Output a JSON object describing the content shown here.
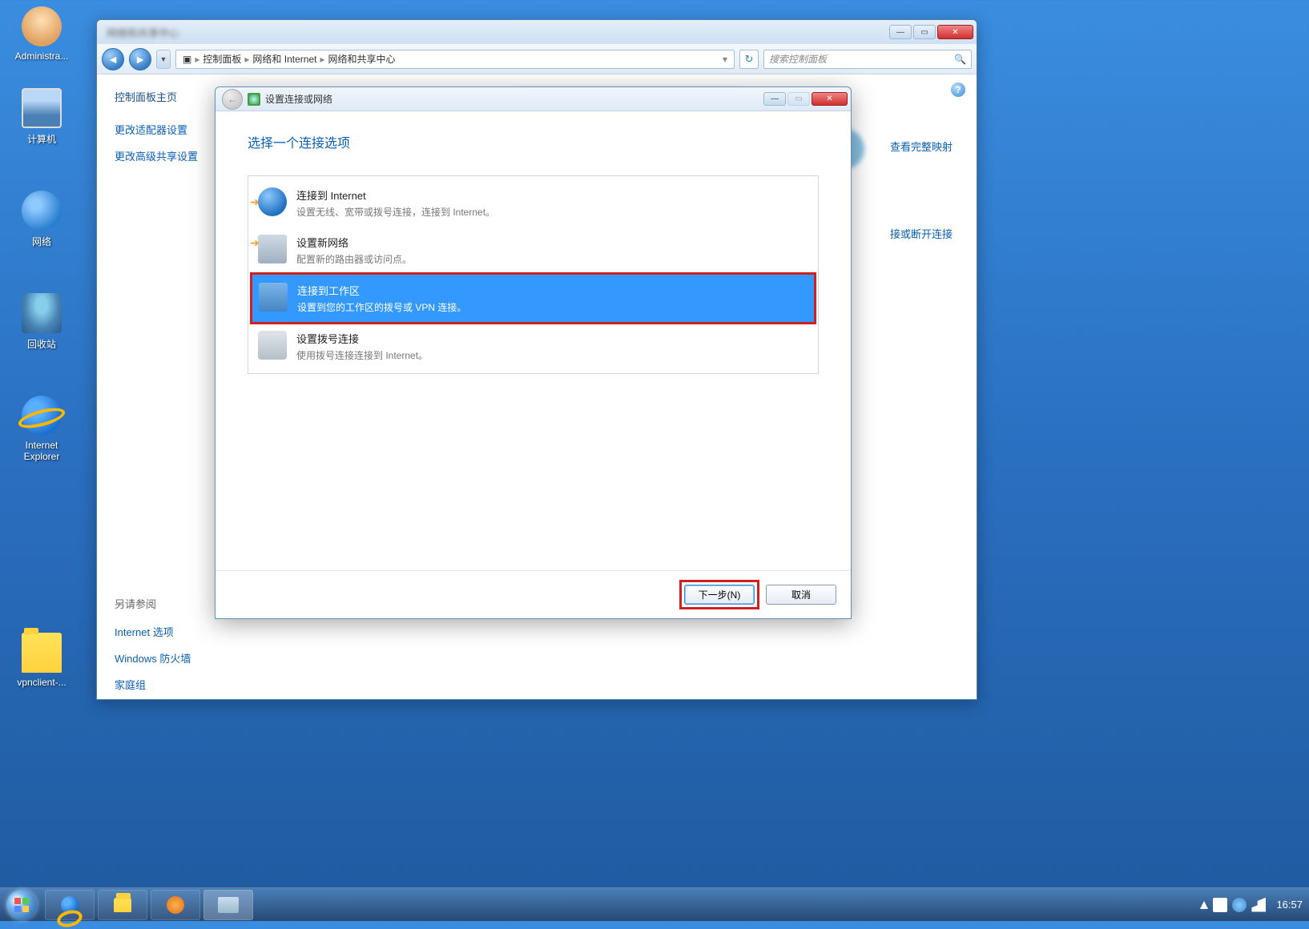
{
  "desktop": {
    "icons": [
      {
        "label": "Administra...",
        "kind": "user"
      },
      {
        "label": "计算机",
        "kind": "computer"
      },
      {
        "label": "网络",
        "kind": "globe"
      },
      {
        "label": "回收站",
        "kind": "recycle"
      },
      {
        "label": "Internet Explorer",
        "kind": "ie"
      },
      {
        "label": "vpnclient-...",
        "kind": "folder"
      }
    ]
  },
  "taskbar": {
    "clock": "16:57"
  },
  "cp_window": {
    "breadcrumb": {
      "root_icon": "control-panel",
      "c1": "控制面板",
      "c2": "网络和 Internet",
      "c3": "网络和共享中心"
    },
    "search_placeholder": "搜索控制面板",
    "sidebar": {
      "home": "控制面板主页",
      "links": [
        "更改适配器设置",
        "更改高级共享设置"
      ],
      "see_also_title": "另请参阅",
      "see_also": [
        "Internet 选项",
        "Windows 防火墙",
        "家庭组"
      ]
    },
    "right_links": [
      "查看完整映射",
      "接或断开连接"
    ]
  },
  "wizard": {
    "title": "设置连接或网络",
    "heading": "选择一个连接选项",
    "options": [
      {
        "title": "连接到 Internet",
        "desc": "设置无线、宽带或拨号连接，连接到 Internet。",
        "icon": "globe"
      },
      {
        "title": "设置新网络",
        "desc": "配置新的路由器或访问点。",
        "icon": "router"
      },
      {
        "title": "连接到工作区",
        "desc": "设置到您的工作区的拨号或 VPN 连接。",
        "icon": "buildings",
        "selected": true,
        "highlighted": true
      },
      {
        "title": "设置拨号连接",
        "desc": "使用拨号连接连接到 Internet。",
        "icon": "phone"
      }
    ],
    "buttons": {
      "next": "下一步(N)",
      "cancel": "取消"
    }
  }
}
